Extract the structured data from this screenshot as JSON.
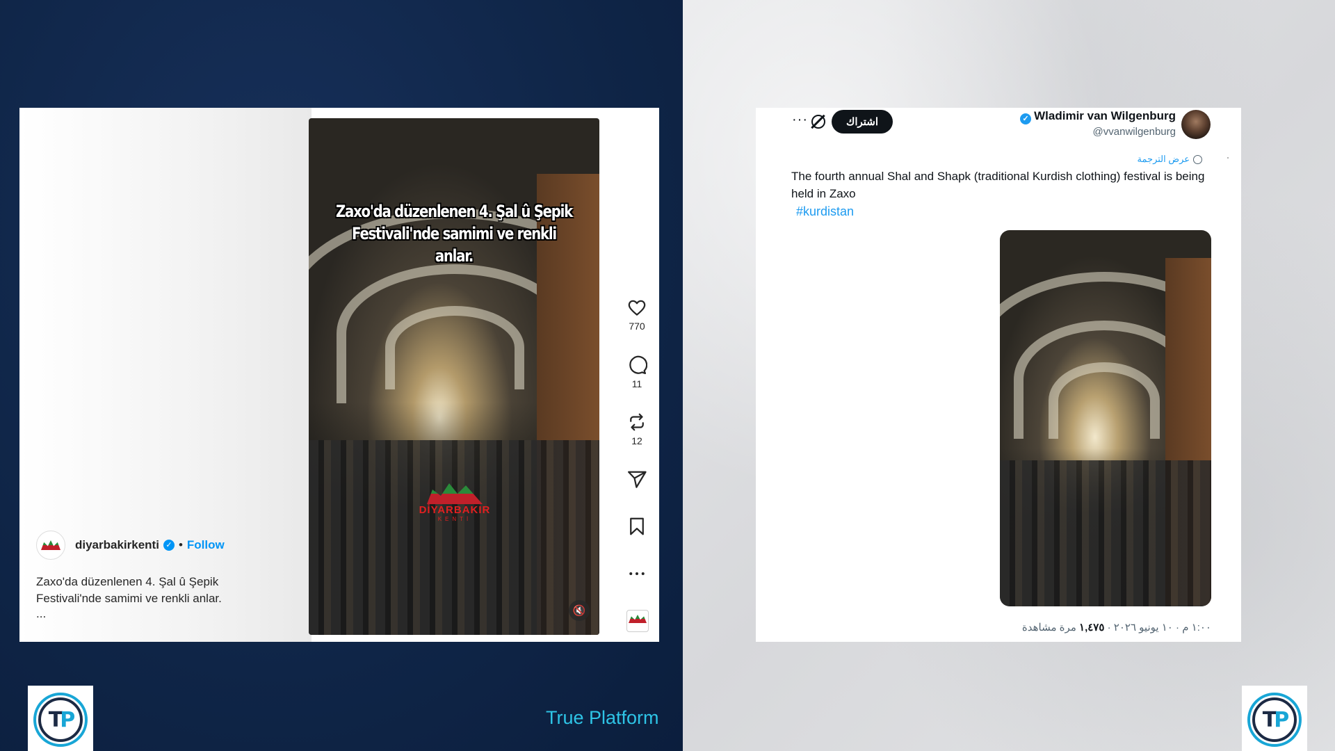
{
  "brand": {
    "name": "True Platform",
    "logo_letters": [
      "T",
      "P"
    ],
    "accent_color": "#2ec4e6",
    "dark_color": "#1c2a44"
  },
  "instagram": {
    "video_overlay_lines": [
      "Zaxo'da düzenlenen 4. Şal û Şepik",
      "Festivali'nde samimi ve renkli anlar."
    ],
    "watermark": {
      "title": "DİYARBAKIR",
      "subtitle": "KENTİ"
    },
    "actions": {
      "like_count": "770",
      "comment_count": "11",
      "repost_count": "12"
    },
    "profile": {
      "username": "diyarbakirkenti",
      "verified_mark": "✓",
      "separator": "•",
      "follow_label": "Follow"
    },
    "caption_lines": [
      "Zaxo'da düzenlenen 4. Şal û Şepik",
      "Festivali'nde samimi ve renkli anlar."
    ],
    "caption_more": "...",
    "icons": [
      "heart-icon",
      "comment-icon",
      "repost-icon",
      "share-icon",
      "bookmark-icon",
      "more-icon",
      "mute-icon"
    ]
  },
  "tweet": {
    "author_name": "Wladimir van Wilgenburg",
    "verified_mark": "✓",
    "handle": "@vvanwilgenburg",
    "subscribe_label": "اشتراك",
    "more_label": "···",
    "translate_label": "عرض الترجمة",
    "text": "The fourth annual Shal and Shapk (traditional Kurdish clothing) festival is being held in Zaxo",
    "hashtag": "#kurdistan",
    "meta": {
      "time_date": "١:٠٠ م · ١٠ يونيو ٢٠٢٦ ·",
      "views_count": "١,٤٧٥",
      "views_label": "مرة مشاهدة"
    },
    "accent_color": "#1d9bf0"
  }
}
